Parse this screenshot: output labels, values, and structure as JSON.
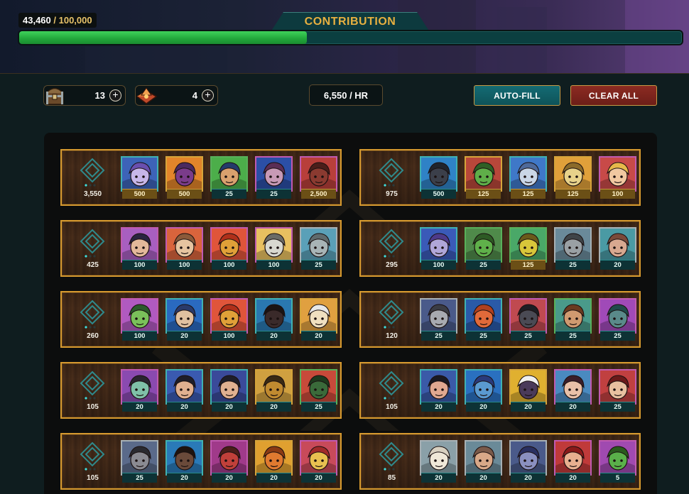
{
  "progress": {
    "current": "43,460",
    "separator": " / ",
    "max": "100,000",
    "fraction": 0.4346,
    "title": "CONTRIBUTION"
  },
  "resources": [
    {
      "icon": "treasure-chest-icon",
      "count": "13"
    },
    {
      "icon": "crystal-crate-icon",
      "count": "4"
    }
  ],
  "rate": "6,550 / HR",
  "buttons": {
    "autofill": "AUTO-FILL",
    "clear_all": "CLEAR ALL"
  },
  "colors": {
    "accent_gold": "#e7b040",
    "teal": "#146b73",
    "red": "#8c2b22",
    "progress_green": "#21a63a"
  },
  "slots": [
    {
      "score": "3,550",
      "cards": [
        {
          "value": "500",
          "tier": "gold",
          "frame": "blue",
          "bg": "#3d63b8",
          "skin": "#c7b6e8",
          "hair": "#6a4fae"
        },
        {
          "value": "500",
          "tier": "gold",
          "frame": "gold",
          "bg": "#e2852a",
          "skin": "#7a3c8a",
          "hair": "#4a2a5f"
        },
        {
          "value": "25",
          "tier": "teal",
          "frame": "green",
          "bg": "#4cae4a",
          "skin": "#d9a06e",
          "hair": "#243b6a"
        },
        {
          "value": "25",
          "tier": "teal",
          "frame": "pink",
          "bg": "#2b4fa6",
          "skin": "#c79ab6",
          "hair": "#5a2d55"
        },
        {
          "value": "2,500",
          "tier": "gold",
          "frame": "pink",
          "bg": "#b83f3a",
          "skin": "#8a3a30",
          "hair": "#4b1e1a"
        }
      ]
    },
    {
      "score": "975",
      "cards": [
        {
          "value": "500",
          "tier": "teal",
          "frame": "blue",
          "bg": "#2f82c6",
          "skin": "#3b3f4a",
          "hair": "#20242c"
        },
        {
          "value": "125",
          "tier": "gold",
          "frame": "gold",
          "bg": "#b8473a",
          "skin": "#5fae49",
          "hair": "#2f5f25"
        },
        {
          "value": "125",
          "tier": "gold",
          "frame": "blue",
          "bg": "#3f78c8",
          "skin": "#c9d6e6",
          "hair": "#4f6a9a"
        },
        {
          "value": "125",
          "tier": "gold",
          "frame": "gold",
          "bg": "#e0a03a",
          "skin": "#e8d28a",
          "hair": "#8a6a2a"
        },
        {
          "value": "100",
          "tier": "gold",
          "frame": "pink",
          "bg": "#c84a48",
          "skin": "#f0c8a0",
          "hair": "#e6b84a"
        }
      ]
    },
    {
      "score": "425",
      "cards": [
        {
          "value": "100",
          "tier": "teal",
          "frame": "pink",
          "bg": "#a85fc0",
          "skin": "#e3b89a",
          "hair": "#2a2440"
        },
        {
          "value": "100",
          "tier": "teal",
          "frame": "pink",
          "bg": "#d9643c",
          "skin": "#e6c4a0",
          "hair": "#8a5a3a"
        },
        {
          "value": "100",
          "tier": "teal",
          "frame": "pink",
          "bg": "#e0553a",
          "skin": "#e0a038",
          "hair": "#b0301a"
        },
        {
          "value": "100",
          "tier": "teal",
          "frame": "pink",
          "bg": "#e8c060",
          "skin": "#d8d8d0",
          "hair": "#6a6a66"
        },
        {
          "value": "25",
          "tier": "teal",
          "frame": "silver",
          "bg": "#5aa0b8",
          "skin": "#a8b4b6",
          "hair": "#5f6a6c"
        }
      ]
    },
    {
      "score": "295",
      "cards": [
        {
          "value": "100",
          "tier": "teal",
          "frame": "blue",
          "bg": "#3a5ab8",
          "skin": "#b0a6d8",
          "hair": "#4d3a8a"
        },
        {
          "value": "25",
          "tier": "teal",
          "frame": "green",
          "bg": "#4f8a4a",
          "skin": "#5fb04a",
          "hair": "#2d5a24"
        },
        {
          "value": "125",
          "tier": "gold",
          "frame": "green",
          "bg": "#4aa868",
          "skin": "#d8c63a",
          "hair": "#6a5a1a"
        },
        {
          "value": "25",
          "tier": "teal",
          "frame": "silver",
          "bg": "#6a8a9a",
          "skin": "#9aa0a4",
          "hair": "#3f4448"
        },
        {
          "value": "20",
          "tier": "teal",
          "frame": "silver",
          "bg": "#4a9aa4",
          "skin": "#d8a890",
          "hair": "#7a4a3a"
        }
      ]
    },
    {
      "score": "260",
      "cards": [
        {
          "value": "100",
          "tier": "teal",
          "frame": "pink",
          "bg": "#b05ac0",
          "skin": "#7ac05a",
          "hair": "#2a5a2a"
        },
        {
          "value": "20",
          "tier": "teal",
          "frame": "blue",
          "bg": "#2a6ac0",
          "skin": "#e0c0a0",
          "hair": "#2a3a6a"
        },
        {
          "value": "100",
          "tier": "teal",
          "frame": "pink",
          "bg": "#e0553a",
          "skin": "#e0a038",
          "hair": "#b0301a"
        },
        {
          "value": "20",
          "tier": "teal",
          "frame": "blue",
          "bg": "#2a78b0",
          "skin": "#3a2a2a",
          "hair": "#1a1414"
        },
        {
          "value": "20",
          "tier": "teal",
          "frame": "gold",
          "bg": "#e0a040",
          "skin": "#f0e0c0",
          "hair": "#e8e8e8"
        }
      ]
    },
    {
      "score": "120",
      "cards": [
        {
          "value": "25",
          "tier": "teal",
          "frame": "silver",
          "bg": "#4a5a8a",
          "skin": "#a8aab0",
          "hair": "#3a3c44"
        },
        {
          "value": "25",
          "tier": "teal",
          "frame": "blue",
          "bg": "#2a5aa8",
          "skin": "#e06a3a",
          "hair": "#b04020"
        },
        {
          "value": "25",
          "tier": "teal",
          "frame": "pink",
          "bg": "#c04a50",
          "skin": "#4a4a54",
          "hair": "#1e1e24"
        },
        {
          "value": "25",
          "tier": "teal",
          "frame": "green",
          "bg": "#4a9a8a",
          "skin": "#d09a70",
          "hair": "#6a3a20"
        },
        {
          "value": "25",
          "tier": "teal",
          "frame": "pink",
          "bg": "#a04ab8",
          "skin": "#5a8a8a",
          "hair": "#204a4a"
        }
      ]
    },
    {
      "score": "105",
      "cards": [
        {
          "value": "20",
          "tier": "teal",
          "frame": "pink",
          "bg": "#8a4ab0",
          "skin": "#7fc0a8",
          "hair": "#2a2430"
        },
        {
          "value": "20",
          "tier": "teal",
          "frame": "blue",
          "bg": "#3a5ab0",
          "skin": "#e0b090",
          "hair": "#1e1e2a"
        },
        {
          "value": "20",
          "tier": "teal",
          "frame": "blue",
          "bg": "#3a4a9a",
          "skin": "#e0b090",
          "hair": "#1e1e2a"
        },
        {
          "value": "20",
          "tier": "teal",
          "frame": "gold",
          "bg": "#d0a040",
          "skin": "#c08a30",
          "hair": "#3a2a14"
        },
        {
          "value": "25",
          "tier": "teal",
          "frame": "green",
          "bg": "#c84a3a",
          "skin": "#3a6a3a",
          "hair": "#1e3a1e"
        }
      ]
    },
    {
      "score": "105",
      "cards": [
        {
          "value": "20",
          "tier": "teal",
          "frame": "blue",
          "bg": "#3a5aa8",
          "skin": "#e0a890",
          "hair": "#1a1a22"
        },
        {
          "value": "20",
          "tier": "teal",
          "frame": "blue",
          "bg": "#2a70c0",
          "skin": "#5a9ad0",
          "hair": "#2a3a7a"
        },
        {
          "value": "20",
          "tier": "teal",
          "frame": "gold",
          "bg": "#e0b030",
          "skin": "#4a3a5a",
          "hair": "#f0f0f0"
        },
        {
          "value": "20",
          "tier": "teal",
          "frame": "pink",
          "bg": "#4a8ac0",
          "skin": "#e8c0a8",
          "hair": "#3a1e2a"
        },
        {
          "value": "25",
          "tier": "teal",
          "frame": "pink",
          "bg": "#c04040",
          "skin": "#e8c0a0",
          "hair": "#6a1a1a"
        }
      ]
    },
    {
      "score": "105",
      "cards": [
        {
          "value": "25",
          "tier": "teal",
          "frame": "silver",
          "bg": "#5a6a8a",
          "skin": "#8a8a92",
          "hair": "#2a2a30"
        },
        {
          "value": "20",
          "tier": "teal",
          "frame": "blue",
          "bg": "#2a7ab8",
          "skin": "#6a4a3a",
          "hair": "#1e1410"
        },
        {
          "value": "20",
          "tier": "teal",
          "frame": "pink",
          "bg": "#a03a8a",
          "skin": "#c0403a",
          "hair": "#4a1e1a"
        },
        {
          "value": "20",
          "tier": "teal",
          "frame": "gold",
          "bg": "#e0a030",
          "skin": "#e07a30",
          "hair": "#8a3a14"
        },
        {
          "value": "20",
          "tier": "teal",
          "frame": "pink",
          "bg": "#c84a5a",
          "skin": "#e8c050",
          "hair": "#a02a2a"
        }
      ]
    },
    {
      "score": "85",
      "cards": [
        {
          "value": "20",
          "tier": "teal",
          "frame": "silver",
          "bg": "#8aa0a8",
          "skin": "#f0e8d8",
          "hair": "#d8d0c0"
        },
        {
          "value": "20",
          "tier": "teal",
          "frame": "silver",
          "bg": "#6a8a98",
          "skin": "#d8a888",
          "hair": "#7a5a4a"
        },
        {
          "value": "20",
          "tier": "teal",
          "frame": "silver",
          "bg": "#4a5a8a",
          "skin": "#8a90c0",
          "hair": "#2a3060"
        },
        {
          "value": "20",
          "tier": "teal",
          "frame": "pink",
          "bg": "#c03a3a",
          "skin": "#e8b090",
          "hair": "#8a1a1a"
        },
        {
          "value": "5",
          "tier": "teal",
          "frame": "pink",
          "bg": "#a04ab0",
          "skin": "#5ab04a",
          "hair": "#2a5a1e"
        }
      ]
    }
  ]
}
